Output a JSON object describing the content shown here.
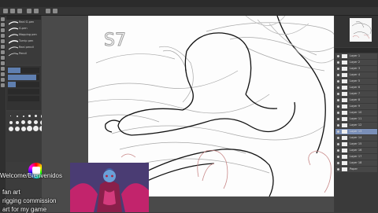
{
  "menu": [
    "File",
    "Edit",
    "Animation",
    "Layer",
    "Select",
    "View",
    "Filter",
    "Window",
    "Help"
  ],
  "subtool": {
    "brushes": [
      "Real G-pen",
      "G-pen",
      "Mapping pen",
      "Turnip pen",
      "Real pencil",
      "Pencil"
    ]
  },
  "layers": [
    "Layer 1",
    "Layer 2",
    "Layer 3",
    "Layer 4",
    "Layer 5",
    "Layer 6",
    "Layer 7",
    "Layer 8",
    "Layer 9",
    "Layer 10",
    "Layer 11",
    "Layer 12",
    "Layer 13",
    "Layer 14",
    "Layer 15",
    "Layer 16",
    "Layer 17",
    "Layer 18",
    "Paper"
  ],
  "canvas": {
    "page_mark": "S7"
  },
  "stream": {
    "welcome": "Welcome/Bienvenidos",
    "lines": [
      "fan art",
      "rigging commission",
      "art for my game"
    ]
  },
  "colors": {
    "ui_dark": "#2b2b2b",
    "panel": "#3a3a3a",
    "canvas": "#fdfdfd",
    "sketch": "#9c9c9c",
    "ink": "#111111",
    "pink_sketch": "#c98a8a"
  }
}
